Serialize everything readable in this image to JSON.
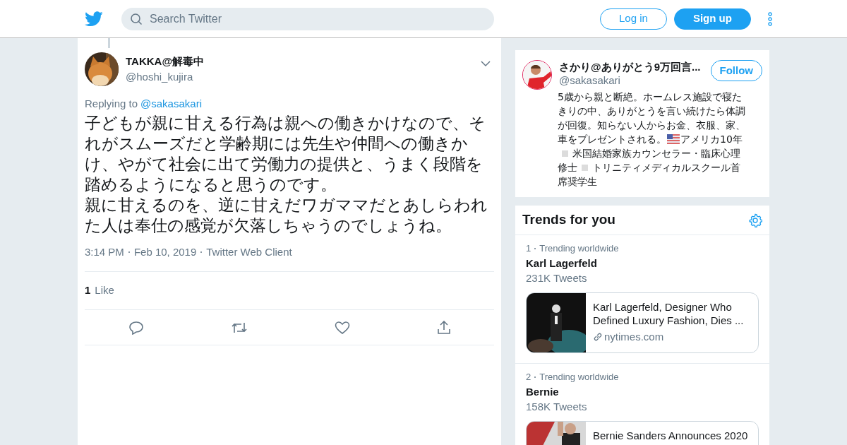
{
  "header": {
    "search": {
      "placeholder": "Search Twitter"
    },
    "buttons": [
      {
        "label": "Log in",
        "kind": "outline"
      },
      {
        "label": "Sign up",
        "kind": "filled"
      }
    ]
  },
  "tweet": {
    "name": "TAKKA@解毒中",
    "handle": "@hoshi_kujira",
    "replying_label": "Replying to",
    "replying_to": "@sakasakari",
    "text_lines": [
      "子どもが親に甘える行為は親への働きかけなので、それがスムーズだと学齢期には先生や仲間への働きかけ、やがて社会に出て労働力の提供と、うまく段階を踏めるようになると思うのです。",
      "親に甘えるのを、逆に甘えだワガママだとあしらわれた人は奉仕の感覚が欠落しちゃうのでしょうね。"
    ],
    "meta": [
      "3:14 PM",
      "Feb 10, 2019",
      "Twitter Web Client"
    ],
    "likes": {
      "count": "1",
      "label": "Like"
    }
  },
  "profile": {
    "name": "さかり@ありがとう9万回言...",
    "handle": "@sakasakari",
    "follow": "Follow",
    "bio_lines": [
      [
        {
          "kind": "text",
          "text": "5歳から親と断絶。ホームレス施設で寝た"
        }
      ],
      [
        {
          "kind": "text",
          "text": "きりの中、ありがとうを言い続けたら体調"
        }
      ],
      [
        {
          "kind": "text",
          "text": "が回復。知らない人からお金、衣服、家、"
        }
      ],
      [
        {
          "kind": "text",
          "text": "車をプレゼントされる。"
        },
        {
          "kind": "flag"
        },
        {
          "kind": "text",
          "text": "アメリカ10年"
        }
      ],
      [
        {
          "kind": "square"
        },
        {
          "kind": "text",
          "text": "米国結婚家族カウンセラー・臨床心理"
        }
      ],
      [
        {
          "kind": "text",
          "text": "修士"
        },
        {
          "kind": "square"
        },
        {
          "kind": "text",
          "text": "トリニティメディカルスクール首"
        }
      ],
      [
        {
          "kind": "text",
          "text": "席奨学生"
        }
      ]
    ]
  },
  "trends": {
    "title": "Trends for you",
    "items": [
      {
        "rank": "1",
        "context": "Trending worldwide",
        "name": "Karl Lagerfeld",
        "count": "231K Tweets",
        "card": {
          "title": "Karl Lagerfeld, Designer Who Defined Luxury Fashion, Dies ...",
          "source": "nytimes.com"
        }
      },
      {
        "rank": "2",
        "context": "Trending worldwide",
        "name": "Bernie",
        "count": "158K Tweets",
        "card": {
          "title": "Bernie Sanders Announces 2020"
        }
      }
    ]
  }
}
